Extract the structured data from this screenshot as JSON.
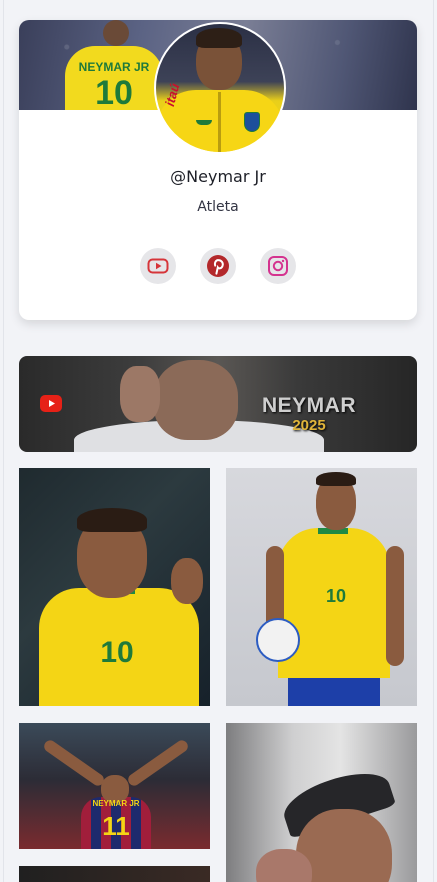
{
  "profile": {
    "cover_alt": "Neymar Jr cover photo",
    "avatar_alt": "Neymar Jr profile photo",
    "handle": "@Neymar Jr",
    "role": "Atleta",
    "cover_jersey_name": "NEYMAR JR",
    "cover_jersey_number": "10",
    "avatar_sponsor": "itaú",
    "socials": [
      {
        "name": "youtube",
        "icon": "youtube-icon",
        "color": "#d6353a"
      },
      {
        "name": "pinterest",
        "icon": "pinterest-icon",
        "color": "#b3282b"
      },
      {
        "name": "instagram",
        "icon": "instagram-icon",
        "color": "#d4338f"
      }
    ]
  },
  "banner": {
    "title": "NEYMAR",
    "year": "2025",
    "icon": "youtube-icon",
    "accent": "#e62117"
  },
  "gallery": {
    "photos": [
      {
        "alt": "Neymar smiling in Brazil jersey",
        "jersey_number": "10"
      },
      {
        "alt": "Neymar posing with ball in Brazil kit",
        "jersey_number": "10"
      },
      {
        "alt": "Neymar celebrating in Barcelona jersey",
        "jersey_number": "11",
        "jersey_name": "NEYMAR JR"
      },
      {
        "alt": "Neymar portrait with cap"
      },
      {
        "alt": "Neymar photo"
      }
    ]
  },
  "colors": {
    "page_bg": "#f2f3f7",
    "card_bg": "#ffffff",
    "text_primary": "#1d1f27",
    "brazil_yellow": "#f4d515",
    "brazil_green": "#1f7a3a"
  }
}
